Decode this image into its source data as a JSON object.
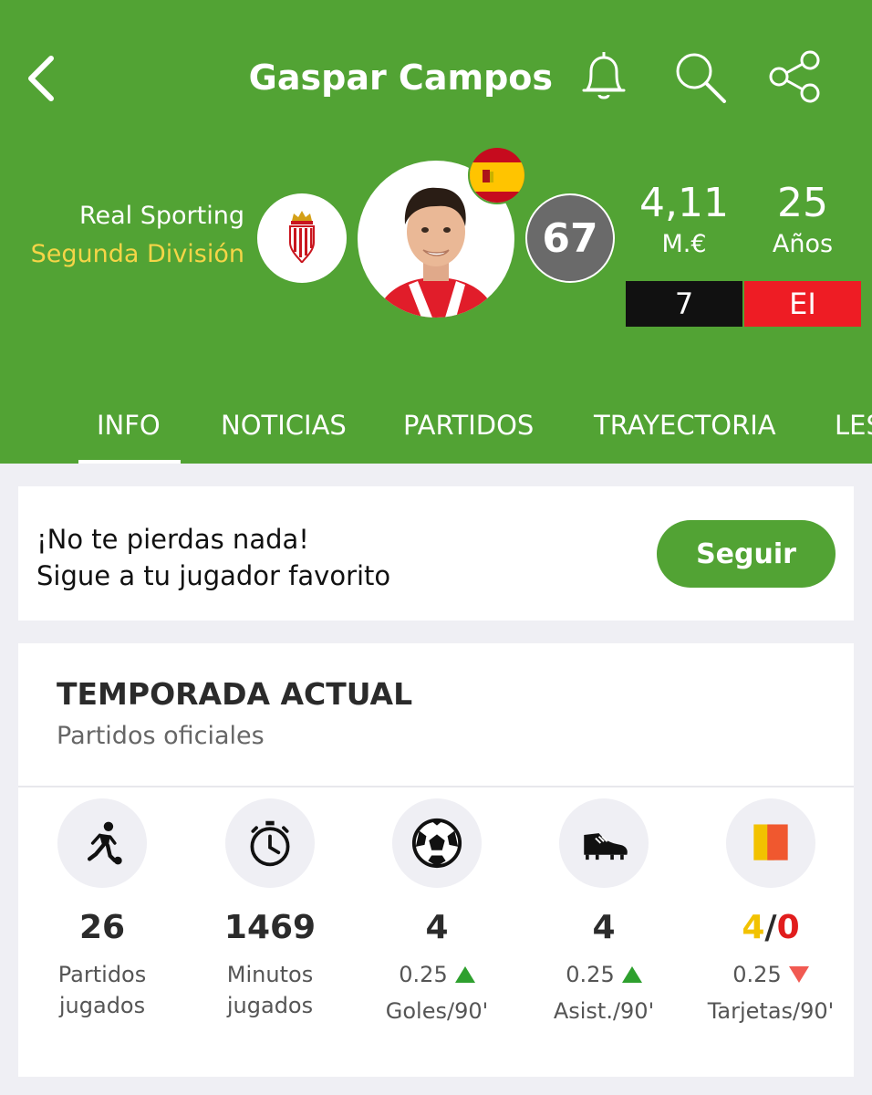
{
  "header": {
    "title": "Gaspar Campos",
    "club": "Real Sporting",
    "league": "Segunda División",
    "rating": "67",
    "market_value": "4,11",
    "market_value_label": "M.€",
    "age": "25",
    "age_label": "Años",
    "shirt_number": "7",
    "position": "EI",
    "icons": [
      "back-chevron-icon",
      "bell-icon",
      "search-icon",
      "share-icon"
    ]
  },
  "tabs": [
    "INFO",
    "NOTICIAS",
    "PARTIDOS",
    "TRAYECTORIA",
    "LES"
  ],
  "follow": {
    "line1": "¡No te pierdas nada!",
    "line2": "Sigue a tu jugador favorito",
    "button": "Seguir"
  },
  "season": {
    "title": "TEMPORADA ACTUAL",
    "subtitle": "Partidos oficiales",
    "stats": [
      {
        "value": "26",
        "label1": "Partidos",
        "label2": "jugados",
        "icon": "player-kick-icon"
      },
      {
        "value": "1469",
        "label1": "Minutos jugados",
        "icon": "stopwatch-icon"
      },
      {
        "value": "4",
        "ratio": "0.25",
        "label1": "Goles/90'",
        "icon": "soccer-ball-icon"
      },
      {
        "value": "4",
        "ratio": "0.25",
        "label1": "Asist./90'",
        "icon": "football-boot-icon"
      },
      {
        "yellow": "4",
        "slash": "/",
        "red": "0",
        "ratio": "0.25",
        "label1": "Tarjetas/90'",
        "icon": "cards-icon"
      }
    ]
  },
  "colors": {
    "brand_green": "#52a334",
    "yellow_card": "#f2c200",
    "red_card": "#e11d1d",
    "trend_up": "#2ea02e",
    "trend_down": "#f15a52"
  }
}
